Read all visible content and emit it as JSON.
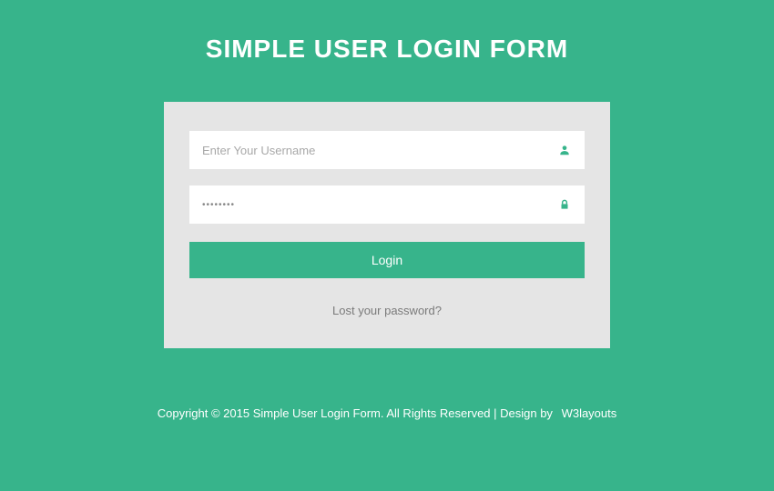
{
  "title": "SIMPLE USER LOGIN FORM",
  "form": {
    "username_placeholder": "Enter Your Username",
    "password_value": "••••••••",
    "login_button": "Login",
    "lost_password": "Lost your password?"
  },
  "footer": {
    "text": "Copyright © 2015 Simple User Login Form. All Rights Reserved | Design by",
    "link": "W3layouts"
  }
}
